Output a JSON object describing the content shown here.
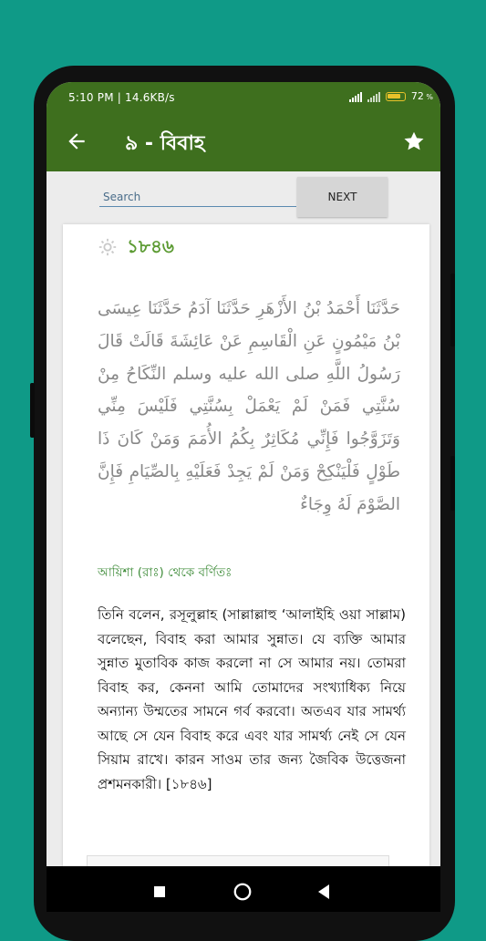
{
  "status_bar": {
    "time_speed": "5:10 PM | 14.6KB/s",
    "battery_percent": "72"
  },
  "app_bar": {
    "title": "৯ - বিবাহ"
  },
  "search": {
    "placeholder": "Search",
    "next_label": "NEXT"
  },
  "hadith": {
    "number": "১৮৪৬",
    "arabic": "حَدَّثَنَا أَحْمَدُ بْنُ الأَزْهَرِ حَدَّثَنَا آدَمُ حَدَّثَنَا عِيسَى بْنُ مَيْمُونٍ عَنِ الْقَاسِمِ عَنْ عَائِشَةَ قَالَتْ قَالَ رَسُولُ اللَّهِ صلى الله عليه وسلم النِّكَاحُ مِنْ سُنَّتِي فَمَنْ لَمْ يَعْمَلْ بِسُنَّتِي فَلَيْسَ مِنِّي وَتَزَوَّجُوا فَإِنِّي مُكَاثِرٌ بِكُمُ الأُمَمَ وَمَنْ كَانَ ذَا طَوْلٍ فَلْيَنْكِحْ وَمَنْ لَمْ يَجِدْ فَعَلَيْهِ بِالصِّيَامِ فَإِنَّ الصَّوْمَ لَهُ وِجَاءٌ",
    "narrator": "আয়িশা (রাঃ) থেকে বর্ণিতঃ",
    "bangla": "তিনি বলেন, রসূলুল্লাহ (সাল্লাল্লাহু ‘আলাইহি ওয়া সাল্লাম) বলেছেন, বিবাহ করা আমার সুন্নাত। যে ব্যক্তি আমার সুন্নাত মুতাবিক কাজ করলো না সে আমার নয়। তোমরা বিবাহ কর, কেননা আমি তোমাদের সংখ্যাধিক্য নিয়ে অন্যান্য উম্মতের সামনে গর্ব করবো। অতএব যার সামর্থ্য আছে সে যেন বিবাহ করে এবং যার সামর্থ্য নেই সে যেন সিয়াম রাখে। কারন সাওম তার জন্য জৈবিক উত্তেজনা প্রশমনকারী। [১৮৪৬]"
  },
  "colors": {
    "primary": "#3e6f1e",
    "accent_green": "#5c9b33",
    "background": "#0f9a87"
  },
  "icons": [
    "back-arrow-icon",
    "star-icon",
    "gear-icon",
    "nav-recents-icon",
    "nav-home-icon",
    "nav-back-icon"
  ]
}
